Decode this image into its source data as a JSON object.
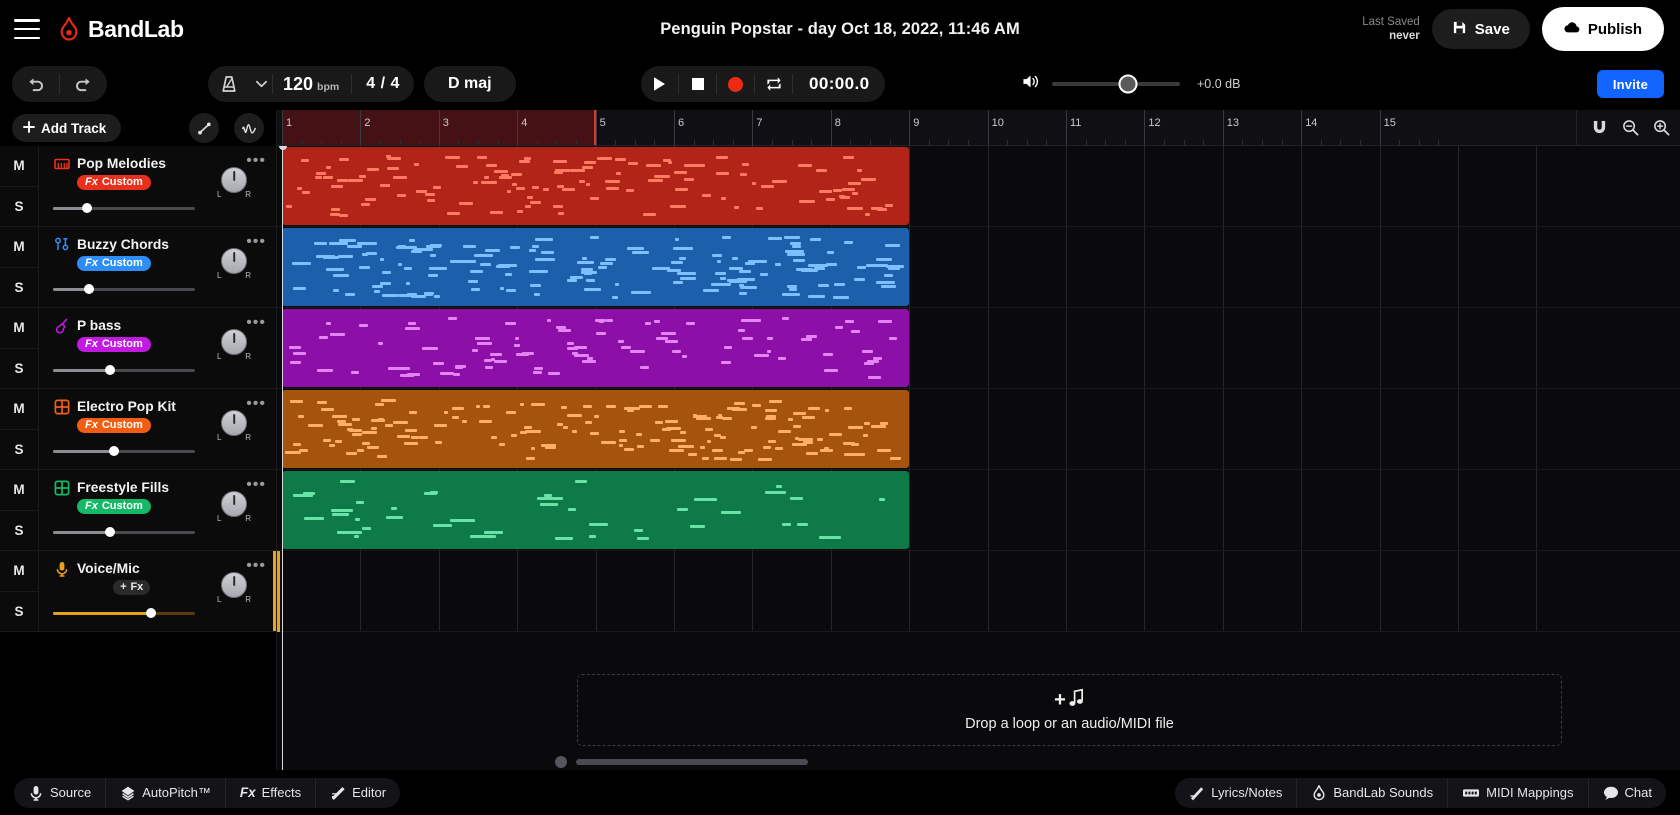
{
  "app": {
    "brand": "BandLab",
    "project_title": "Penguin Popstar - day Oct 18, 2022, 11:46 AM"
  },
  "header": {
    "menu_icon": "hamburger-menu-icon",
    "logo_icon": "bandlab-logo-icon",
    "last_saved_label": "Last Saved",
    "last_saved_value": "never",
    "save_label": "Save",
    "save_icon": "floppy-disk-icon",
    "publish_label": "Publish",
    "publish_icon": "cloud-upload-icon"
  },
  "transport": {
    "undo_icon": "undo-arrow-icon",
    "redo_icon": "redo-arrow-icon",
    "metronome_icon": "metronome-icon",
    "metronome_chevron_icon": "chevron-down-icon",
    "bpm_value": "120",
    "bpm_unit": "bpm",
    "time_signature": "4 / 4",
    "key_signature": "D maj",
    "play_icon": "play-icon",
    "stop_icon": "stop-icon",
    "record_icon": "record-icon",
    "loop_icon": "loop-repeat-icon",
    "timecode": "00:00.0",
    "speaker_icon": "speaker-volume-icon",
    "master_volume_percent": 59,
    "master_db": "+0.0 dB",
    "invite_label": "Invite"
  },
  "sidebar": {
    "add_track_label": "Add Track",
    "add_track_icon": "plus-icon",
    "automation_icon": "automation-curve-icon",
    "waveform_icon": "waveform-icon",
    "mute_label": "M",
    "solo_label": "S",
    "more_icon": "more-options-icon",
    "pan_left_label": "L",
    "pan_right_label": "R"
  },
  "tracks": [
    {
      "name": "Pop Melodies",
      "icon": "midi-keyboard-icon",
      "fx_label": "Fx Custom",
      "fx_prefix": "Fx",
      "fx_suffix": "Custom",
      "color": "#e8301c",
      "clip_color": "#b22318",
      "note_color": "#ff7a63",
      "volume_percent": 24,
      "pan": "center",
      "clip_start_bar": 1,
      "clip_end_bar": 9
    },
    {
      "name": "Buzzy Chords",
      "icon": "synth-knobs-icon",
      "fx_label": "Fx Custom",
      "fx_prefix": "Fx",
      "fx_suffix": "Custom",
      "color": "#2e8ef7",
      "clip_color": "#1c5fab",
      "note_color": "#7dc0ff",
      "volume_percent": 25,
      "pan": "center",
      "clip_start_bar": 1,
      "clip_end_bar": 9
    },
    {
      "name": "P bass",
      "icon": "bass-guitar-icon",
      "fx_label": "Fx Custom",
      "fx_prefix": "Fx",
      "fx_suffix": "Custom",
      "color": "#c11ae0",
      "clip_color": "#8c0fa8",
      "note_color": "#e583f5",
      "volume_percent": 40,
      "pan": "center",
      "clip_start_bar": 1,
      "clip_end_bar": 9
    },
    {
      "name": "Electro Pop Kit",
      "icon": "drum-pad-grid-icon",
      "fx_label": "Fx Custom",
      "fx_prefix": "Fx",
      "fx_suffix": "Custom",
      "color": "#f25d13",
      "clip_color": "#a6540d",
      "note_color": "#ffb066",
      "volume_percent": 43,
      "pan": "center",
      "clip_start_bar": 1,
      "clip_end_bar": 9
    },
    {
      "name": "Freestyle Fills",
      "icon": "drum-pad-grid-icon",
      "fx_label": "Fx Custom",
      "fx_prefix": "Fx",
      "fx_suffix": "Custom",
      "color": "#14b866",
      "clip_color": "#0d7a47",
      "note_color": "#69e3a5",
      "volume_percent": 40,
      "pan": "center",
      "clip_start_bar": 1,
      "clip_end_bar": 9
    },
    {
      "name": "Voice/Mic",
      "icon": "microphone-icon",
      "fx_label": "+ Fx",
      "fx_prefix": "+",
      "fx_suffix": "Fx",
      "color": "#e8a21c",
      "clip_color": "",
      "note_color": "",
      "volume_percent": 69,
      "pan": "center",
      "clip_start_bar": 0,
      "clip_end_bar": 0
    }
  ],
  "timeline": {
    "bar_numbers": [
      "1",
      "2",
      "3",
      "4",
      "5",
      "6",
      "7",
      "8",
      "9",
      "10",
      "11",
      "12",
      "13",
      "14",
      "15"
    ],
    "loop_start_bar": 1,
    "loop_end_bar": 5,
    "playhead_bar": 1,
    "loop_color": "#8c1616",
    "snap_icon": "magnet-snap-icon",
    "zoom_out_icon": "zoom-out-icon",
    "zoom_in_icon": "zoom-in-icon"
  },
  "dropzone": {
    "plus": "+",
    "note_icon": "music-note-icon",
    "text": "Drop a loop or an audio/MIDI file"
  },
  "bottom_left": [
    {
      "label": "Source",
      "icon": "microphone-icon"
    },
    {
      "label": "AutoPitch™",
      "icon": "autopitch-icon"
    },
    {
      "label": "Effects",
      "icon": "fx-icon",
      "prefix": "Fx"
    },
    {
      "label": "Editor",
      "icon": "editor-pencil-icon"
    }
  ],
  "bottom_right": [
    {
      "label": "Lyrics/Notes",
      "icon": "pencil-note-icon"
    },
    {
      "label": "BandLab Sounds",
      "icon": "bandlab-logo-icon"
    },
    {
      "label": "MIDI Mappings",
      "icon": "midi-connector-icon"
    },
    {
      "label": "Chat",
      "icon": "chat-bubble-icon"
    }
  ]
}
